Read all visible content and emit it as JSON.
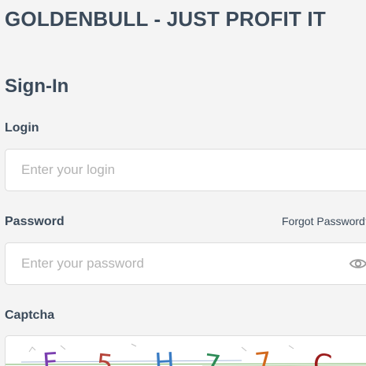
{
  "header": {
    "title": "GOLDENBULL - JUST PROFIT IT"
  },
  "form": {
    "title": "Sign-In",
    "login": {
      "label": "Login",
      "placeholder": "Enter your login",
      "value": ""
    },
    "password": {
      "label": "Password",
      "placeholder": "Enter your password",
      "value": "",
      "forgot_link": "Forgot Password?",
      "toggle_icon": "eye-icon"
    },
    "captcha": {
      "label": "Captcha",
      "characters": [
        {
          "char": "F",
          "color": "#7b3fb0"
        },
        {
          "char": "5",
          "color": "#b5443a"
        },
        {
          "char": "H",
          "color": "#3a7cc4"
        },
        {
          "char": "7",
          "color": "#2e8b57"
        },
        {
          "char": "7",
          "color": "#d2691e"
        },
        {
          "char": "C",
          "color": "#9b1c1c"
        }
      ]
    }
  },
  "colors": {
    "background": "#f4f4f4",
    "text": "#3b4a5a",
    "placeholder": "#b3b3b3",
    "input_border": "#dcdcdc"
  }
}
